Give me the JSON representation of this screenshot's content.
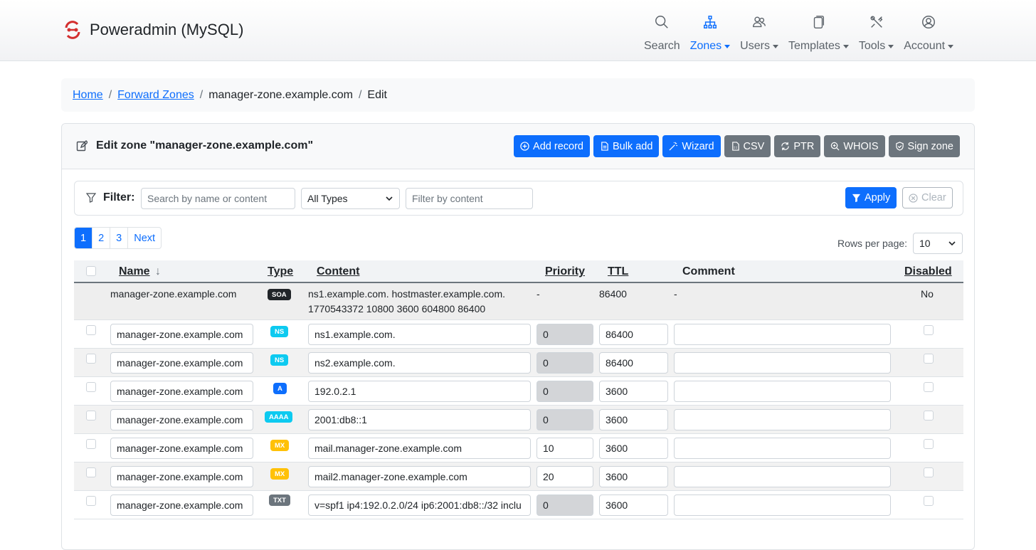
{
  "header": {
    "brand": "Poweradmin (MySQL)",
    "nav": [
      {
        "label": "Search",
        "icon": "search-icon",
        "active": false,
        "dropdown": false
      },
      {
        "label": "Zones",
        "icon": "sitemap-icon",
        "active": true,
        "dropdown": true
      },
      {
        "label": "Users",
        "icon": "users-icon",
        "active": false,
        "dropdown": true
      },
      {
        "label": "Templates",
        "icon": "copy-icon",
        "active": false,
        "dropdown": true
      },
      {
        "label": "Tools",
        "icon": "tools-icon",
        "active": false,
        "dropdown": true
      },
      {
        "label": "Account",
        "icon": "account-icon",
        "active": false,
        "dropdown": true
      }
    ],
    "accent_color": "#0d6efd",
    "brand_color": "#d32f2f"
  },
  "breadcrumb": {
    "home": "Home",
    "forward_zones": "Forward Zones",
    "zone": "manager-zone.example.com",
    "current": "Edit",
    "separator": "/"
  },
  "card": {
    "title": "Edit zone \"manager-zone.example.com\"",
    "buttons": {
      "add_record": "Add record",
      "bulk_add": "Bulk add",
      "wizard": "Wizard",
      "csv": "CSV",
      "ptr": "PTR",
      "whois": "WHOIS",
      "sign_zone": "Sign zone"
    }
  },
  "filter": {
    "label": "Filter:",
    "name_placeholder": "Search by name or content",
    "type_selected": "All Types",
    "content_placeholder": "Filter by content",
    "apply": "Apply",
    "clear": "Clear"
  },
  "pagination": {
    "pages": [
      "1",
      "2",
      "3"
    ],
    "next": "Next",
    "active_page": "1",
    "rows_per_page_label": "Rows per page:",
    "rows_per_page": "10"
  },
  "table": {
    "columns": {
      "name": "Name",
      "sort_indicator": "↓",
      "type": "Type",
      "content": "Content",
      "priority": "Priority",
      "ttl": "TTL",
      "comment": "Comment",
      "disabled": "Disabled"
    },
    "soa": {
      "name": "manager-zone.example.com",
      "type": "SOA",
      "content_line1": "ns1.example.com. hostmaster.example.com.",
      "content_line2": "1770543372 10800 3600 604800 86400",
      "priority": "-",
      "ttl": "86400",
      "comment": "-",
      "disabled": "No"
    },
    "rows": [
      {
        "name": "manager-zone.example.com",
        "type": "NS",
        "content": "ns1.example.com.",
        "priority": "0",
        "ttl": "86400",
        "comment": ""
      },
      {
        "name": "manager-zone.example.com",
        "type": "NS",
        "content": "ns2.example.com.",
        "priority": "0",
        "ttl": "86400",
        "comment": ""
      },
      {
        "name": "manager-zone.example.com",
        "type": "A",
        "content": "192.0.2.1",
        "priority": "0",
        "ttl": "3600",
        "comment": ""
      },
      {
        "name": "manager-zone.example.com",
        "type": "AAAA",
        "content": "2001:db8::1",
        "priority": "0",
        "ttl": "3600",
        "comment": ""
      },
      {
        "name": "manager-zone.example.com",
        "type": "MX",
        "content": "mail.manager-zone.example.com",
        "priority": "10",
        "ttl": "3600",
        "comment": ""
      },
      {
        "name": "manager-zone.example.com",
        "type": "MX",
        "content": "mail2.manager-zone.example.com",
        "priority": "20",
        "ttl": "3600",
        "comment": ""
      },
      {
        "name": "manager-zone.example.com",
        "type": "TXT",
        "content": "v=spf1 ip4:192.0.2.0/24 ip6:2001:db8::/32 inclu",
        "priority": "0",
        "ttl": "3600",
        "comment": ""
      }
    ]
  }
}
